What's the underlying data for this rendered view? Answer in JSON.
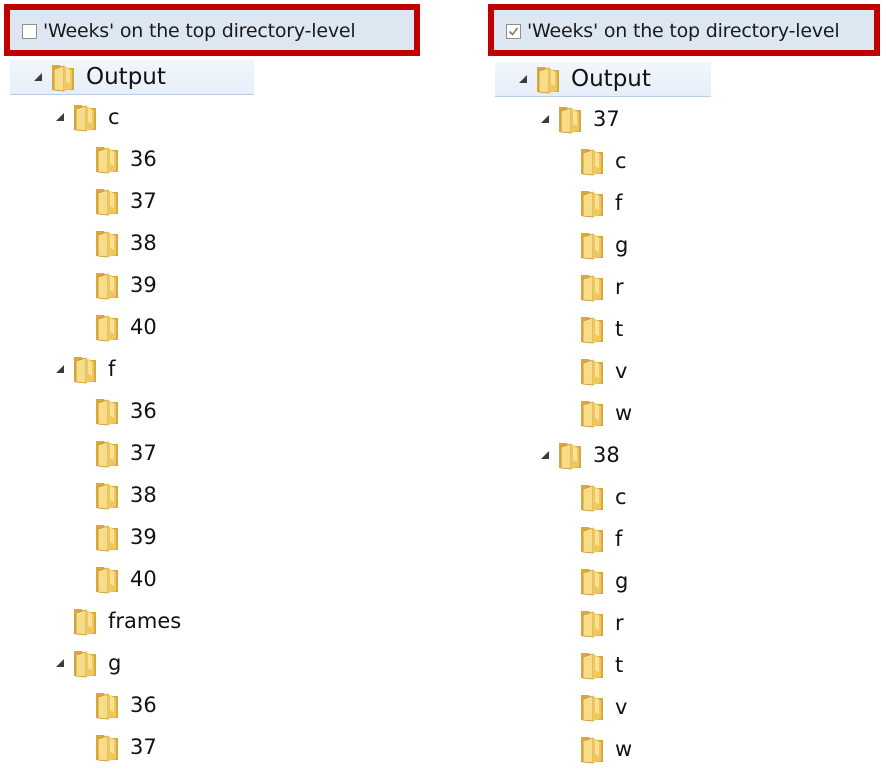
{
  "left_panel": {
    "option": {
      "label": "'Weeks' on the top directory-level",
      "checked": false
    },
    "tree": {
      "label": "Output",
      "expanded": true,
      "children": [
        {
          "label": "c",
          "expanded": true,
          "children": [
            {
              "label": "36"
            },
            {
              "label": "37"
            },
            {
              "label": "38"
            },
            {
              "label": "39"
            },
            {
              "label": "40"
            }
          ]
        },
        {
          "label": "f",
          "expanded": true,
          "children": [
            {
              "label": "36"
            },
            {
              "label": "37"
            },
            {
              "label": "38"
            },
            {
              "label": "39"
            },
            {
              "label": "40"
            }
          ]
        },
        {
          "label": "frames"
        },
        {
          "label": "g",
          "expanded": true,
          "children": [
            {
              "label": "36"
            },
            {
              "label": "37"
            }
          ]
        }
      ]
    }
  },
  "right_panel": {
    "option": {
      "label": "'Weeks' on the top directory-level",
      "checked": true
    },
    "tree": {
      "label": "Output",
      "expanded": true,
      "children": [
        {
          "label": "37",
          "expanded": true,
          "children": [
            {
              "label": "c"
            },
            {
              "label": "f"
            },
            {
              "label": "g"
            },
            {
              "label": "r"
            },
            {
              "label": "t"
            },
            {
              "label": "v"
            },
            {
              "label": "w"
            }
          ]
        },
        {
          "label": "38",
          "expanded": true,
          "children": [
            {
              "label": "c"
            },
            {
              "label": "f"
            },
            {
              "label": "g"
            },
            {
              "label": "r"
            },
            {
              "label": "t"
            },
            {
              "label": "v"
            },
            {
              "label": "w"
            }
          ]
        }
      ]
    }
  },
  "colors": {
    "highlight_border": "#c00000",
    "option_background": "#dde7f2",
    "folder": "#e8c15a"
  },
  "icons": {
    "folder": "folder-icon",
    "expander": "expand-triangle-icon",
    "check": "check-icon"
  }
}
